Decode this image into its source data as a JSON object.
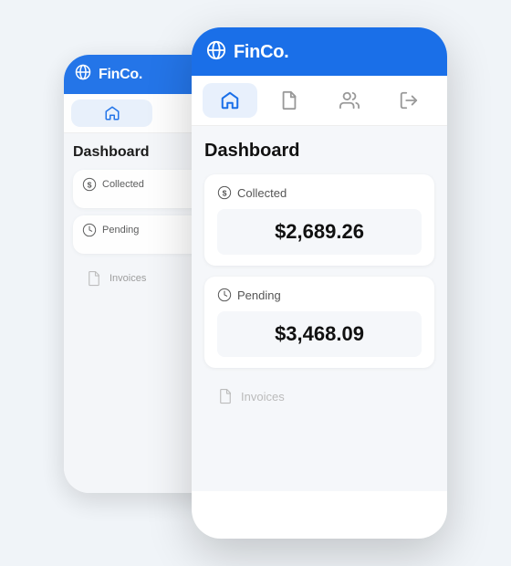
{
  "app": {
    "name": "FinCo.",
    "logo_symbol": "🌐"
  },
  "nav": {
    "tabs": [
      {
        "id": "home",
        "label": "Home",
        "active": true
      },
      {
        "id": "documents",
        "label": "Documents",
        "active": false
      },
      {
        "id": "users",
        "label": "Users",
        "active": false
      },
      {
        "id": "logout",
        "label": "Logout",
        "active": false
      }
    ]
  },
  "dashboard": {
    "title": "Dashboard",
    "cards": [
      {
        "id": "collected",
        "label": "Collected",
        "value": "$2,689.26",
        "icon": "dollar-circle"
      },
      {
        "id": "pending",
        "label": "Pending",
        "value": "$3,468.09",
        "icon": "clock"
      }
    ],
    "bottom_nav": {
      "label": "Invoices",
      "icon": "file"
    }
  }
}
